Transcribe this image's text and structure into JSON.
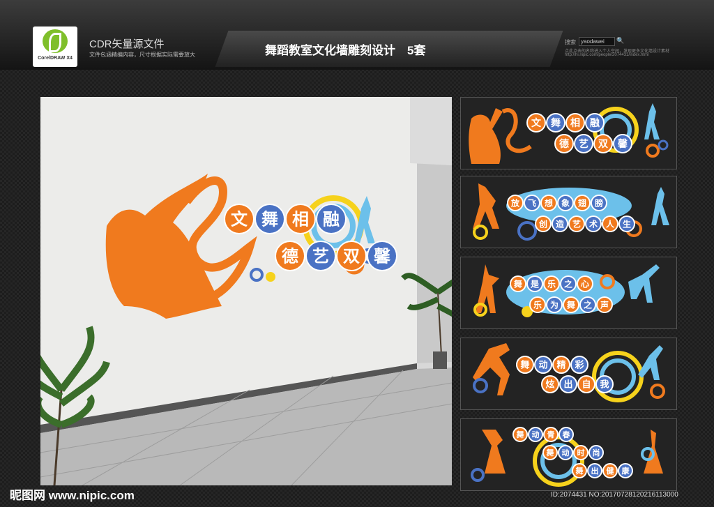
{
  "header": {
    "logo_text": "CorelDRAW X4",
    "cdr_title": "CDR矢量源文件",
    "cdr_subtitle": "文件包涵精编内容，尺寸根据实际需要放大",
    "main_title": "舞蹈教室文化墙雕刻设计　5套",
    "search_label": "搜索",
    "search_value": "yaodawei",
    "note1": "点此点击的名称进入个人空间，发现更多文化墙设计素材",
    "note2": "http://hi.nipic.com/people/2074431/index.html"
  },
  "colors": {
    "orange": "#f07a1e",
    "blue": "#4a72c4",
    "sky": "#6cc0ea",
    "yellow": "#f6d21c",
    "dark": "#232323"
  },
  "scene": {
    "line1": [
      "文",
      "舞",
      "相",
      "融"
    ],
    "line2": [
      "德",
      "艺",
      "双",
      "馨"
    ]
  },
  "panels": [
    {
      "line1": [
        "文",
        "舞",
        "相",
        "融"
      ],
      "line2": [
        "德",
        "艺",
        "双",
        "馨"
      ]
    },
    {
      "line1": [
        "放",
        "飞",
        "想",
        "象",
        "翅",
        "膀"
      ],
      "line2": [
        "创",
        "造",
        "艺",
        "术",
        "人",
        "生"
      ]
    },
    {
      "line1": [
        "舞",
        "是",
        "乐",
        "之",
        "心"
      ],
      "line2": [
        "乐",
        "为",
        "舞",
        "之",
        "声"
      ]
    },
    {
      "line1": [
        "舞",
        "动",
        "精",
        "彩"
      ],
      "line2": [
        "炫",
        "出",
        "自",
        "我"
      ]
    },
    {
      "line1": [
        "舞",
        "动",
        "青",
        "春"
      ],
      "line2": [
        "舞",
        "动",
        "时",
        "尚"
      ],
      "line3": [
        "舞",
        "出",
        "健",
        "康"
      ]
    }
  ],
  "watermark": {
    "left": "昵图网 www.nipic.com",
    "id": "ID:2074431 NO:20170728120216113000"
  }
}
